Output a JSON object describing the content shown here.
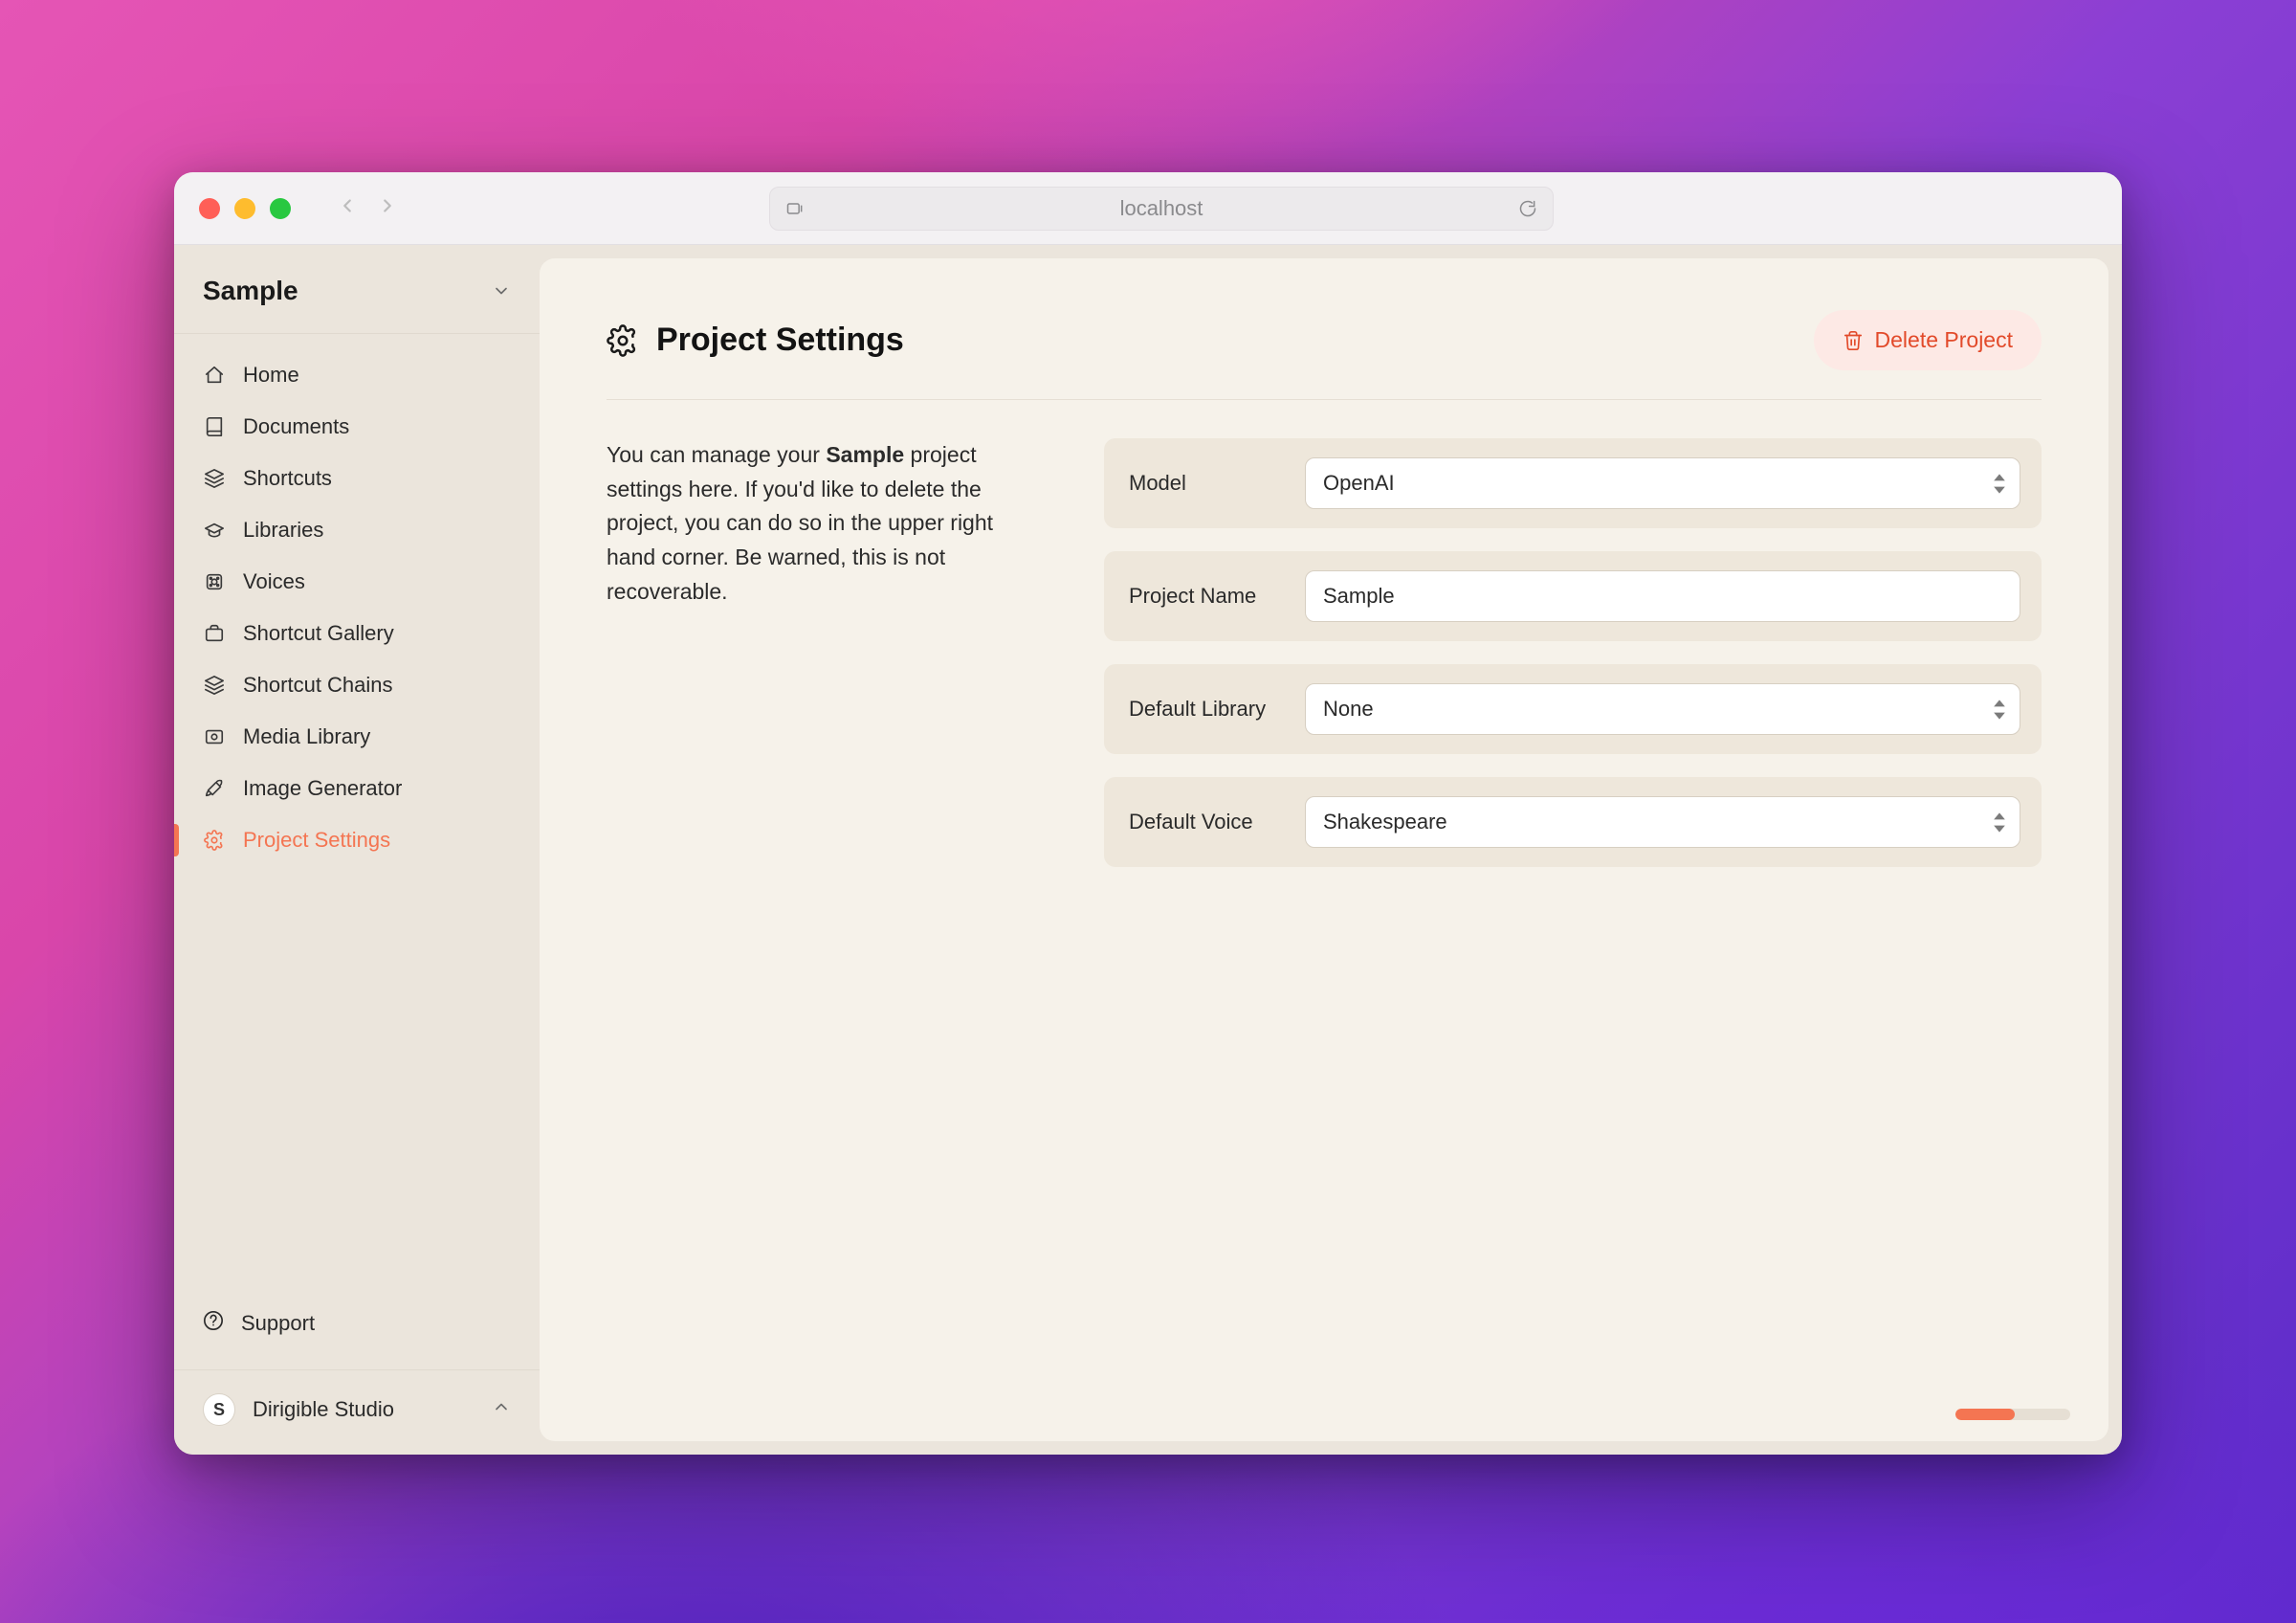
{
  "browser": {
    "url_display": "localhost"
  },
  "sidebar": {
    "project_name": "Sample",
    "items": [
      {
        "label": "Home",
        "icon": "home-icon"
      },
      {
        "label": "Documents",
        "icon": "document-icon"
      },
      {
        "label": "Shortcuts",
        "icon": "stack-icon"
      },
      {
        "label": "Libraries",
        "icon": "graduation-cap-icon"
      },
      {
        "label": "Voices",
        "icon": "voice-icon"
      },
      {
        "label": "Shortcut Gallery",
        "icon": "briefcase-icon"
      },
      {
        "label": "Shortcut Chains",
        "icon": "stack-icon"
      },
      {
        "label": "Media Library",
        "icon": "media-icon"
      },
      {
        "label": "Image Generator",
        "icon": "rocket-icon"
      },
      {
        "label": "Project Settings",
        "icon": "gear-icon"
      }
    ],
    "active_index": 9,
    "support_label": "Support",
    "workspace": {
      "avatar_letter": "S",
      "name": "Dirigible Studio"
    }
  },
  "page": {
    "title": "Project Settings",
    "delete_label": "Delete Project",
    "description_pre": "You can manage your ",
    "description_bold": "Sample",
    "description_post": " project settings here. If you'd like to delete the project, you can do so in the upper right hand corner. Be warned, this is not recoverable."
  },
  "form": {
    "model": {
      "label": "Model",
      "value": "OpenAI"
    },
    "project_name": {
      "label": "Project Name",
      "value": "Sample"
    },
    "default_library": {
      "label": "Default Library",
      "value": "None"
    },
    "default_voice": {
      "label": "Default Voice",
      "value": "Shakespeare"
    }
  },
  "colors": {
    "accent": "#f47552",
    "danger": "#e24a2a"
  }
}
